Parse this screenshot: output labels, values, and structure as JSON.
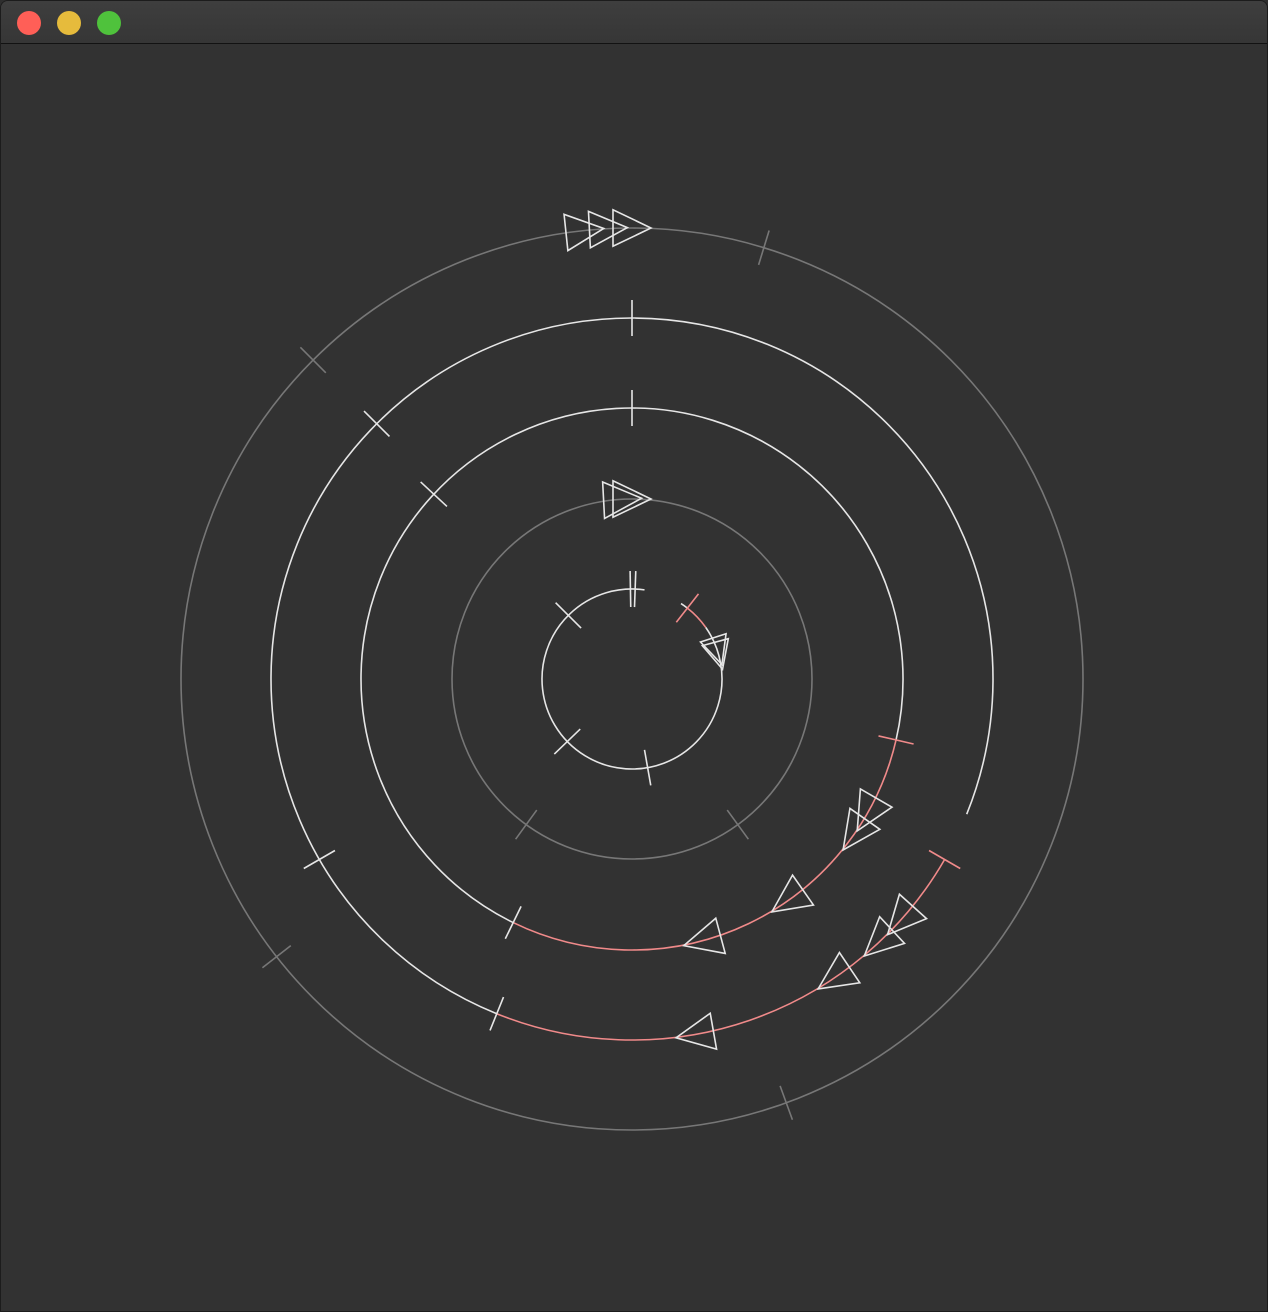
{
  "window": {
    "title": "",
    "buttons": {
      "close_color": "#ff5f57",
      "minimize_color": "#e6bb3c",
      "zoom_color": "#4fc23c"
    },
    "background": "#323232"
  },
  "visualization": {
    "type": "concentric-circular-sequencer",
    "colors": {
      "dim_ring": "#777777",
      "bright_ring": "#e6e6e6",
      "highlight": "#f08a8a",
      "marker": "#e6e6e6"
    },
    "rings": [
      {
        "name": "outer-ring",
        "style": "dim",
        "ticks_deg": [
          -73,
          70,
          142,
          225
        ],
        "highlight_deg": null,
        "triangles_deg": [
          -96,
          -93,
          -90
        ]
      },
      {
        "name": "ring-2",
        "style": "bright",
        "ticks_deg": [
          -90,
          -135,
          150
        ],
        "highlight_deg": [
          30,
          112
        ],
        "highlight_ticks_deg": [
          30
        ],
        "gap_deg": [
          22,
          30
        ],
        "end_tick_deg": 112,
        "triangles_deg": [
          42,
          47,
          56,
          80
        ]
      },
      {
        "name": "ring-3",
        "style": "bright",
        "ticks_deg": [
          -90,
          -137
        ],
        "highlight_deg": [
          13,
          116
        ],
        "highlight_ticks_deg": [
          13
        ],
        "end_tick_deg": 116,
        "triangles_deg": [
          30,
          35,
          55,
          75
        ]
      },
      {
        "name": "ring-4",
        "style": "dim",
        "ticks_deg": [
          54,
          126
        ],
        "highlight_deg": null,
        "triangles_deg": [
          -93,
          -90
        ]
      },
      {
        "name": "inner-ring",
        "style": "bright",
        "ticks_deg": [
          -91,
          -88,
          -135,
          136,
          80
        ],
        "highlight_deg": [
          -52,
          -35
        ],
        "highlight_ticks_deg": [
          -52
        ],
        "gap_deg": [
          -82,
          -57
        ],
        "triangles_deg": [
          -18,
          -15
        ]
      }
    ]
  }
}
